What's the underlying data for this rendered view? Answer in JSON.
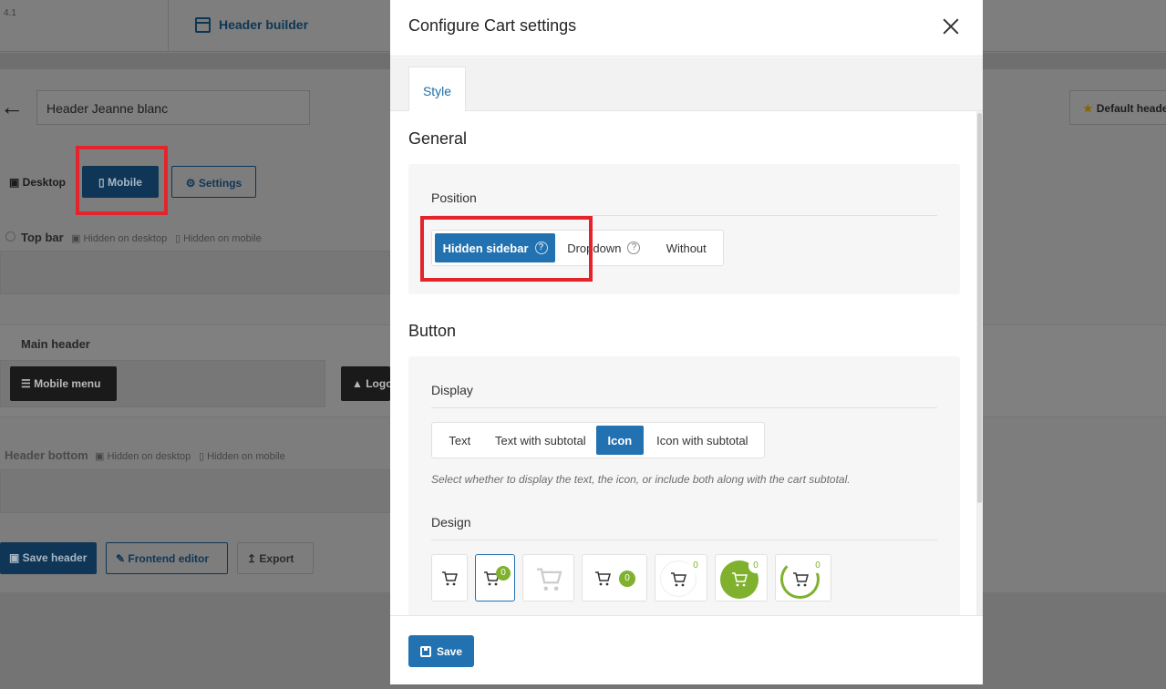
{
  "background": {
    "version": "4.1",
    "header_builder_title": "Header builder",
    "header_name": "Header Jeanne blanc",
    "default_button": "Default header",
    "tabs": {
      "desktop": "Desktop",
      "mobile": "Mobile",
      "settings": "Settings"
    },
    "top_bar": {
      "label": "Top bar",
      "hidden_desktop": "Hidden on desktop",
      "hidden_mobile": "Hidden on mobile"
    },
    "main_header": {
      "label": "Main header",
      "mobile_menu": "Mobile menu",
      "logo": "Logo"
    },
    "header_bottom": {
      "label": "Header bottom",
      "hidden_desktop": "Hidden on desktop",
      "hidden_mobile": "Hidden on mobile"
    },
    "buttons": {
      "save_header": "Save header",
      "frontend_editor": "Frontend editor",
      "export": "Export"
    }
  },
  "modal": {
    "title": "Configure Cart settings",
    "tabs": [
      {
        "label": "Style",
        "active": true
      }
    ],
    "general": {
      "title": "General",
      "position": {
        "label": "Position",
        "options": [
          {
            "label": "Hidden sidebar",
            "active": true,
            "help": "?"
          },
          {
            "label": "Dropdown",
            "active": false,
            "help": "?"
          },
          {
            "label": "Without",
            "active": false
          }
        ]
      }
    },
    "button": {
      "title": "Button",
      "display": {
        "label": "Display",
        "options": [
          {
            "label": "Text",
            "active": false
          },
          {
            "label": "Text with subtotal",
            "active": false
          },
          {
            "label": "Icon",
            "active": true
          },
          {
            "label": "Icon with subtotal",
            "active": false
          }
        ],
        "hint": "Select whether to display the text, the icon, or include both along with the cart subtotal."
      },
      "design": {
        "label": "Design",
        "options": [
          {
            "style": "plain",
            "badge": ""
          },
          {
            "style": "badge-top",
            "badge": "0",
            "selected": true
          },
          {
            "style": "light-outline",
            "badge": ""
          },
          {
            "style": "badge-right",
            "badge": "0"
          },
          {
            "style": "circle-outline",
            "badge": "0"
          },
          {
            "style": "filled-circle",
            "badge": "0"
          },
          {
            "style": "ring",
            "badge": "0"
          }
        ]
      }
    },
    "footer": {
      "save_label": "Save"
    },
    "colors": {
      "accent": "#2271b1",
      "badge_green": "#7fb12e",
      "highlight": "#e3252b"
    }
  }
}
